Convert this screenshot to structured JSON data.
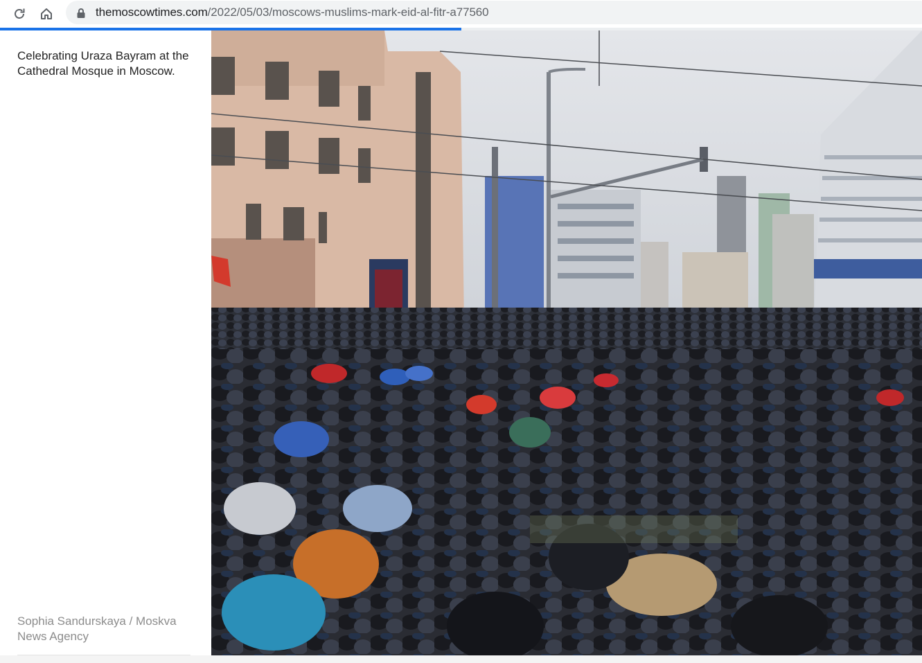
{
  "browser": {
    "url_host": "themoscowtimes.com",
    "url_path": "/2022/05/03/moscows-muslims-mark-eid-al-fitr-a77560",
    "icons": {
      "reload": "reload-icon",
      "home": "home-icon",
      "lock": "lock-icon"
    },
    "load_progress": 0.5
  },
  "article": {
    "caption": "Celebrating Uraza Bayram at the Cathedral Mosque in Moscow.",
    "credit": "Sophia Sandurskaya / Moskva News Agency"
  },
  "colors": {
    "accent": "#1a73e8",
    "caption_text": "#222222",
    "credit_text": "#8c8c8c"
  }
}
